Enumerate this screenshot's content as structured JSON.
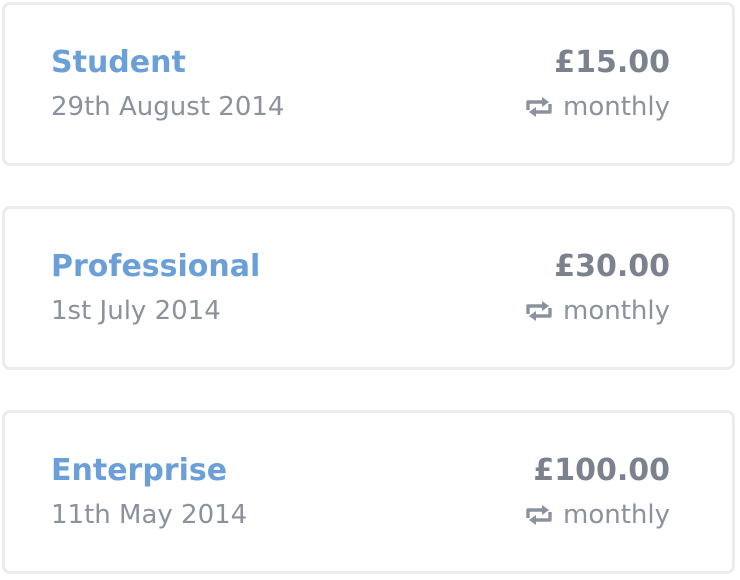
{
  "subscriptions": [
    {
      "name": "Student",
      "date": "29th August 2014",
      "price": "£15.00",
      "interval": "monthly",
      "icon": "repeat-icon"
    },
    {
      "name": "Professional",
      "date": "1st July 2014",
      "price": "£30.00",
      "interval": "monthly",
      "icon": "repeat-icon"
    },
    {
      "name": "Enterprise",
      "date": "11th May 2014",
      "price": "£100.00",
      "interval": "monthly",
      "icon": "repeat-icon"
    }
  ],
  "colors": {
    "plan_name": "#6a9fd8",
    "price": "#7b828d",
    "secondary_text": "#8b929d",
    "card_border": "#ececec"
  }
}
